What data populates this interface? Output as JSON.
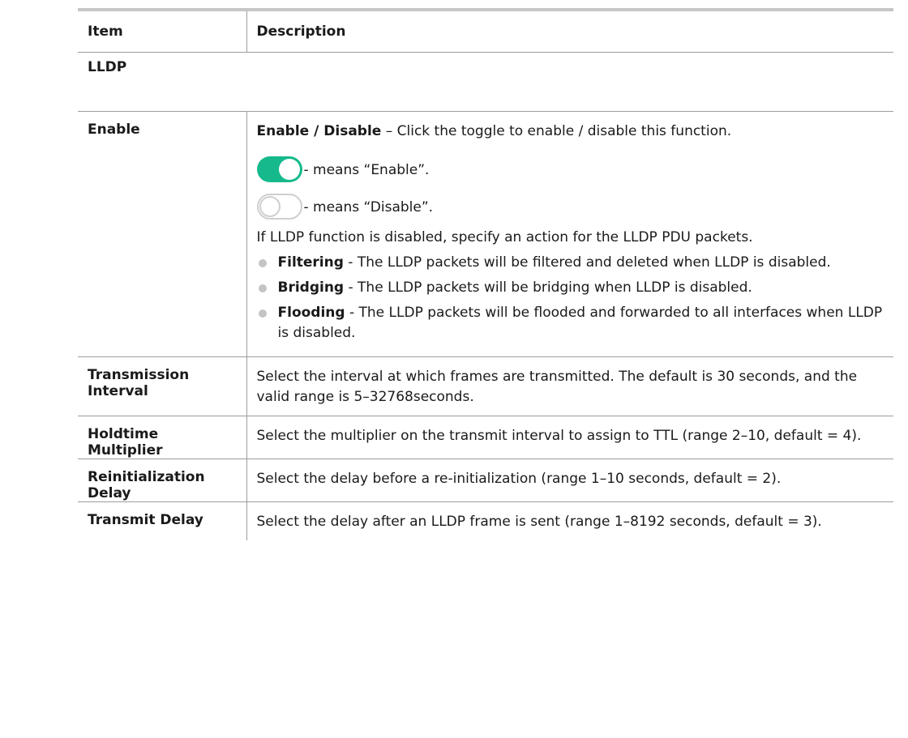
{
  "table": {
    "header": {
      "item": "Item",
      "description": "Description"
    },
    "section_title": "LLDP",
    "enable": {
      "label": "Enable",
      "intro_bold": "Enable / Disable",
      "intro_rest": " – Click the toggle to enable / disable this function.",
      "toggle_on_text": "- means “Enable”.",
      "toggle_off_text": "- means “Disable”.",
      "note": "If LLDP function is disabled, specify an action for the LLDP PDU packets.",
      "bullets": [
        {
          "term": "Filtering",
          "text": " - The LLDP packets will be filtered and deleted when LLDP is disabled."
        },
        {
          "term": "Bridging",
          "text": " - The LLDP packets will be bridging when LLDP is disabled."
        },
        {
          "term": "Flooding",
          "text": " - The LLDP packets will be flooded and forwarded to all interfaces when LLDP is disabled."
        }
      ]
    },
    "rows": [
      {
        "label": "Transmission Interval",
        "text": "Select the interval at which frames are transmitted. The default is 30 seconds, and the valid range is 5–32768seconds."
      },
      {
        "label": "Holdtime Multiplier",
        "text": "Select the multiplier on the transmit interval to assign to TTL (range 2–10, default = 4)."
      },
      {
        "label": "Reinitialization Delay",
        "text": "Select the delay before a re-initialization (range 1–10 seconds, default = 2)."
      },
      {
        "label": "Transmit Delay",
        "text": "Select the delay after an LLDP frame is sent (range 1–8192 seconds, default = 3)."
      }
    ]
  },
  "colors": {
    "toggle_on": "#15b98b",
    "toggle_off_border": "#cfcfcf",
    "rule": "#9d9d9d",
    "bullet": "#c4c4c4"
  },
  "icons": {
    "toggle_on": "toggle-on-icon",
    "toggle_off": "toggle-off-icon",
    "bullet": "bullet-dot-icon"
  }
}
